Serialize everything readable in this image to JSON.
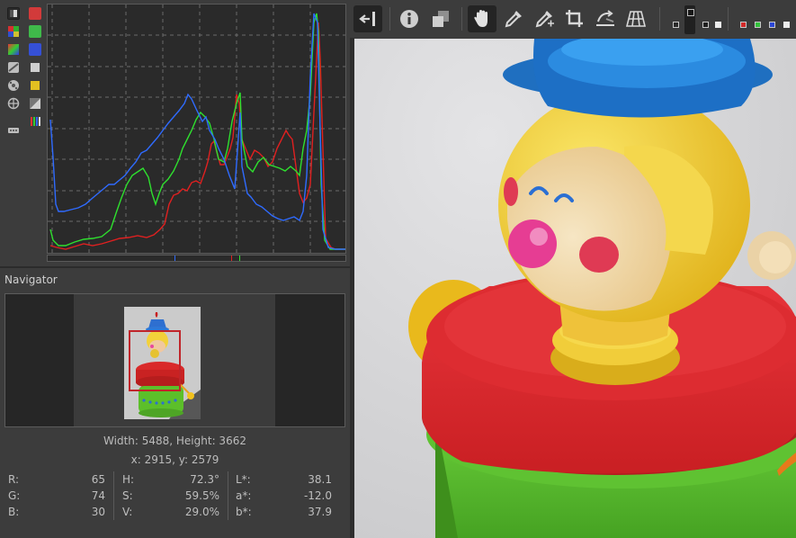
{
  "navigator": {
    "title": "Navigator",
    "image_size": "Width: 5488, Height: 3662",
    "cursor_pos": "x: 2915, y: 2579"
  },
  "pixel_info": {
    "rgb": [
      {
        "label": "R:",
        "value": "65"
      },
      {
        "label": "G:",
        "value": "74"
      },
      {
        "label": "B:",
        "value": "30"
      }
    ],
    "hsv": [
      {
        "label": "H:",
        "value": "72.3°"
      },
      {
        "label": "S:",
        "value": "59.5%"
      },
      {
        "label": "V:",
        "value": "29.0%"
      }
    ],
    "lab": [
      {
        "label": "L*:",
        "value": "38.1"
      },
      {
        "label": "a*:",
        "value": "-12.0"
      },
      {
        "label": "b*:",
        "value": "37.9"
      }
    ]
  },
  "histogram_buttons": [
    {
      "name": "histogram-full-range-icon",
      "pressed": true
    },
    {
      "name": "histogram-red-icon",
      "color": "#d23a3a",
      "pressed": true
    },
    {
      "name": "histogram-rgb-bars-icon",
      "pressed": false
    },
    {
      "name": "histogram-green-icon",
      "color": "#3fb94a",
      "pressed": true
    },
    {
      "name": "histogram-chroma-icon",
      "pressed": false
    },
    {
      "name": "histogram-blue-icon",
      "color": "#3550d6",
      "pressed": true
    },
    {
      "name": "histogram-raw-icon",
      "pressed": false
    },
    {
      "name": "histogram-luminance-icon",
      "color": "#cfcfcf",
      "pressed": false
    },
    {
      "name": "histogram-pointer-icon",
      "pressed": false
    },
    {
      "name": "histogram-chroma-channel-icon",
      "color": "#e3c021",
      "pressed": false
    },
    {
      "name": "histogram-crosshair-icon",
      "pressed": false
    },
    {
      "name": "histogram-bar-icon",
      "pressed": false
    },
    {
      "name": "histogram-options-icon",
      "pressed": false
    },
    {
      "name": "histogram-mode-icon",
      "pressed": false
    }
  ],
  "toolbar": {
    "tools": [
      {
        "name": "toggle-panel-button",
        "icon": "panel-collapse-icon",
        "active": true
      },
      {
        "name": "info-button",
        "icon": "info-icon",
        "active": false
      },
      {
        "name": "before-after-button",
        "icon": "before-after-icon",
        "active": false
      },
      {
        "name": "hand-tool-button",
        "icon": "hand-icon",
        "active": true
      },
      {
        "name": "white-balance-picker-button",
        "icon": "eyedropper-icon",
        "active": false
      },
      {
        "name": "color-picker-button",
        "icon": "eyedropper-plus-icon",
        "active": false
      },
      {
        "name": "crop-tool-button",
        "icon": "crop-icon",
        "active": false
      },
      {
        "name": "straighten-tool-button",
        "icon": "straighten-icon",
        "active": false
      },
      {
        "name": "perspective-tool-button",
        "icon": "perspective-icon",
        "active": false
      }
    ],
    "focus_mask_icon": "focus-mask-icon",
    "indicator_swatches": [
      {
        "name": "gray-indicator-swatch",
        "color": "#2a2a2a"
      },
      {
        "name": "darkgray-indicator-swatch",
        "color": "#1f1f1f"
      },
      {
        "name": "white-indicator-swatch",
        "color": "#ededed"
      }
    ],
    "channel_swatches": [
      {
        "name": "red-channel-swatch",
        "color": "#d22a2a"
      },
      {
        "name": "green-channel-swatch",
        "color": "#33c23c"
      },
      {
        "name": "blue-channel-swatch",
        "color": "#2b47d6"
      },
      {
        "name": "luminance-channel-swatch",
        "color": "#ececec"
      }
    ]
  },
  "colors": {
    "histogram_red": "#e02020",
    "histogram_green": "#2ee02e",
    "histogram_blue": "#2f6bff",
    "navigator_frame": "#c0252a"
  }
}
